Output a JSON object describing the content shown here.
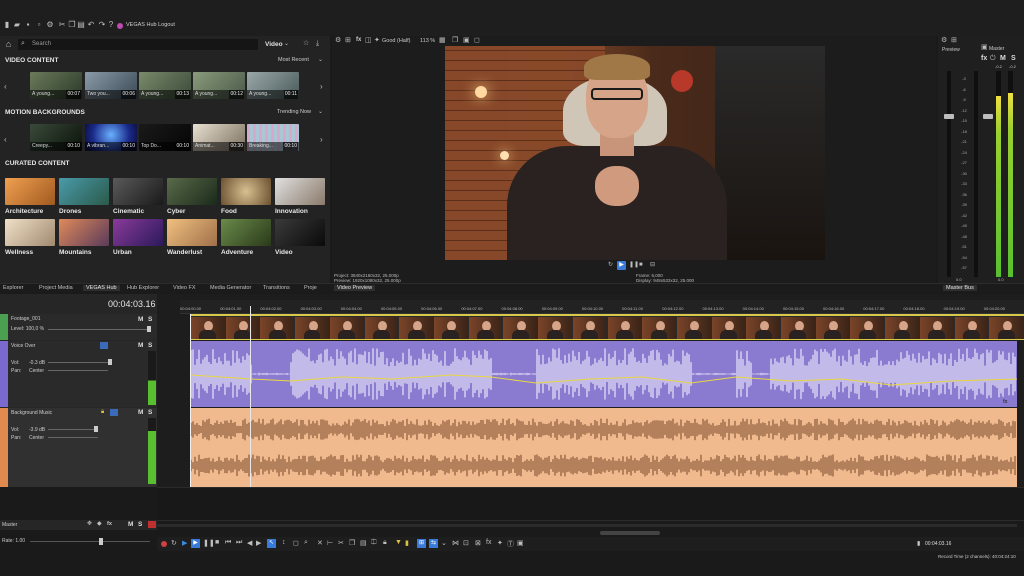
{
  "app": {
    "logout_label": "VEGAS Hub Logout"
  },
  "hub": {
    "search_placeholder": "Search",
    "filter_value": "Video",
    "video_content": {
      "title": "VIDEO CONTENT",
      "sort": "Most Recent",
      "items": [
        {
          "caption": "A young...",
          "duration": "00:07"
        },
        {
          "caption": "Two you...",
          "duration": "00:06"
        },
        {
          "caption": "A young...",
          "duration": "00:13"
        },
        {
          "caption": "A young...",
          "duration": "00:12"
        },
        {
          "caption": "A young...",
          "duration": "00:11"
        }
      ]
    },
    "motion_backgrounds": {
      "title": "MOTION BACKGROUNDS",
      "sort": "Trending Now",
      "items": [
        {
          "caption": "Creepy...",
          "duration": "00:10"
        },
        {
          "caption": "A vibran...",
          "duration": "00:10"
        },
        {
          "caption": "Top Do...",
          "duration": "00:10"
        },
        {
          "caption": "Animat...",
          "duration": "00:30"
        },
        {
          "caption": "Breaking...",
          "duration": "00:10"
        }
      ]
    },
    "curated": {
      "title": "CURATED CONTENT",
      "items": [
        {
          "label": "Architecture",
          "color": "#d58a3c"
        },
        {
          "label": "Drones",
          "color": "#3d7a8c"
        },
        {
          "label": "Cinematic",
          "color": "#3a3a3a"
        },
        {
          "label": "Cyber",
          "color": "#4a5a3a"
        },
        {
          "label": "Food",
          "color": "#b9a37a"
        },
        {
          "label": "Innovation",
          "color": "#c7c7c7"
        },
        {
          "label": "Wellness",
          "color": "#d9c9b5"
        },
        {
          "label": "Mountains",
          "color": "#b06a4a"
        },
        {
          "label": "Urban",
          "color": "#5a3a7a"
        },
        {
          "label": "Wanderlust",
          "color": "#d8a46a"
        },
        {
          "label": "Adventure",
          "color": "#4a6a3a"
        },
        {
          "label": "Video",
          "color": "#2a2a2a"
        }
      ]
    }
  },
  "tabs": [
    {
      "label": "Explorer"
    },
    {
      "label": "Project Media"
    },
    {
      "label": "VEGAS Hub"
    },
    {
      "label": "Hub Explorer"
    },
    {
      "label": "Video FX"
    },
    {
      "label": "Media Generator"
    },
    {
      "label": "Transitions"
    },
    {
      "label": "Proje"
    }
  ],
  "preview": {
    "quality": "Good (Half)",
    "zoom": "113 %",
    "tab_label": "Video Preview",
    "info": {
      "project": "Project:  3840x2160x32, 25.000p",
      "preview": "Preview:  1920x1080x32, 25.000p",
      "frame": "Frame:     6,000",
      "display": "Display:   948x533x32, 25.000"
    }
  },
  "mixer": {
    "preview_label": "Preview",
    "master_label": "Master",
    "master_bus_tab": "Master Bus",
    "scale": [
      "-3",
      "-6",
      "-9",
      "-12",
      "-15",
      "-18",
      "-21",
      "-24",
      "-27",
      "-30",
      "-33",
      "-36",
      "-39",
      "-42",
      "-45",
      "-48",
      "-51",
      "-54",
      "-57"
    ],
    "peak_left": "-0.2",
    "peak_right": "-0.2",
    "bottom_left": "0.0",
    "bottom_right": "0.0"
  },
  "timeline": {
    "timecode": "00:04:03.16",
    "ruler_times": [
      "00:04:00.00",
      "00:04:01.00",
      "00:04:02.00",
      "00:04:03.00",
      "00:04:04.00",
      "00:04:05.00",
      "00:04:06.00",
      "00:04:07.00",
      "00:04:08.00",
      "00:04:09.00",
      "00:04:10.00",
      "00:04:11.00",
      "00:04:12.00",
      "00:04:13.00",
      "00:04:14.00",
      "00:04:15.00",
      "00:04:16.00",
      "00:04:17.00",
      "00:04:18.00",
      "00:04:19.00",
      "00:04:20.00"
    ],
    "tracks": [
      {
        "name": "Footage_001",
        "level": "Level: 100,0 %"
      },
      {
        "name": "Voice Over",
        "vol": "Vol:",
        "vol_value": "-0.3 dB",
        "pan": "Pan:",
        "pan_value": "Center"
      },
      {
        "name": "Background Music",
        "vol": "Vol:",
        "vol_value": "-3.9 dB",
        "pan": "Pan:",
        "pan_value": "Center"
      }
    ],
    "master_label": "Master",
    "rate_label": "Rate: 1.00",
    "mute": "M",
    "solo": "S",
    "status_timecode": "00:04:03.16",
    "record_time": "Record Time (2 channels): 40:04:24:10"
  },
  "colors": {
    "voice_track": "#8a7ad0",
    "music_track": "#f0b98e",
    "video_border": "#d9c94a",
    "waveform_voice": "#e8e4f8",
    "waveform_music": "#8a5a3a"
  }
}
